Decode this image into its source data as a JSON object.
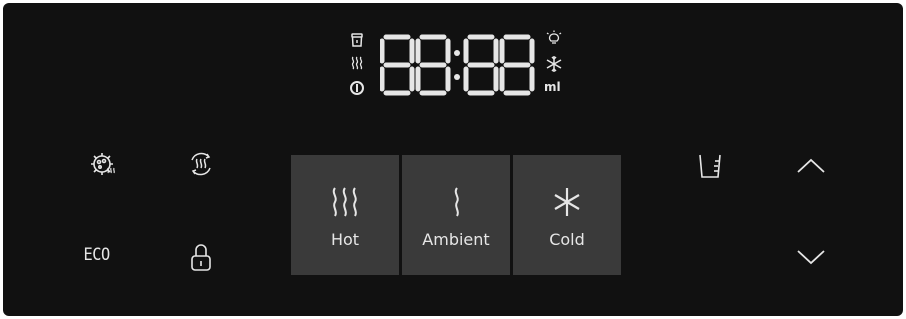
{
  "display": {
    "digits": "88:88",
    "unit_ml": "ml",
    "indicator_icons": [
      "cup-icon",
      "heating-icon",
      "drop-icon",
      "bulb-icon",
      "snowflake-icon"
    ]
  },
  "controls": {
    "left": {
      "sterilize_icon": "sterilize-icon",
      "reheat_icon": "reheat-icon",
      "eco_label": "ECO",
      "lock_icon": "lock-icon"
    },
    "modes": [
      {
        "label": "Hot",
        "icon": "hot-icon"
      },
      {
        "label": "Ambient",
        "icon": "ambient-icon"
      },
      {
        "label": "Cold",
        "icon": "cold-icon"
      }
    ],
    "right": {
      "cup_icon": "cup-volume-icon",
      "up_icon": "chevron-up-icon",
      "down_icon": "chevron-down-icon"
    }
  },
  "colors": {
    "panel": "#111111",
    "button": "#3a3a3a",
    "foreground": "#e6e6e6"
  }
}
